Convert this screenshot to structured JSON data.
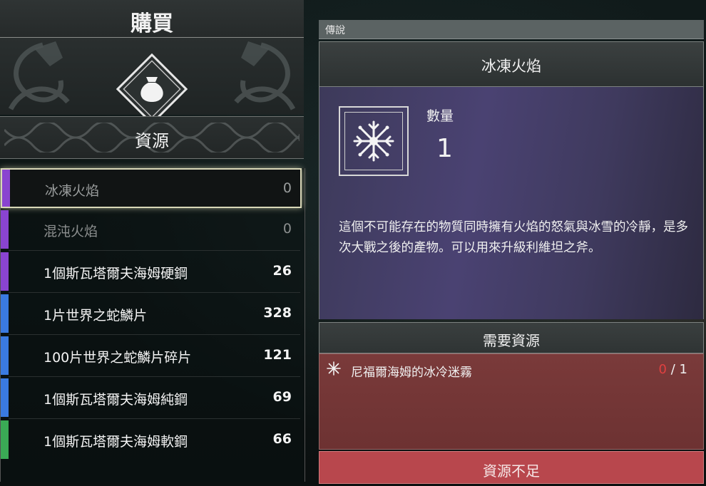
{
  "shop": {
    "title": "購買",
    "emblem_icon": "coin-pouch-icon",
    "category": "資源"
  },
  "items": [
    {
      "name": "冰凍火焰",
      "count": "0",
      "stripe": "#8a44d0",
      "state": "selected"
    },
    {
      "name": "混沌火焰",
      "count": "0",
      "stripe": "#8a44d0",
      "state": "dim"
    },
    {
      "name": "1個斯瓦塔爾夫海姆硬鋼",
      "count": "26",
      "stripe": "#8a44d0",
      "state": "bright"
    },
    {
      "name": "1片世界之蛇鱗片",
      "count": "328",
      "stripe": "#3a7ae0",
      "state": "bright"
    },
    {
      "name": "100片世界之蛇鱗片碎片",
      "count": "121",
      "stripe": "#3a7ae0",
      "state": "bright"
    },
    {
      "name": "1個斯瓦塔爾夫海姆純鋼",
      "count": "69",
      "stripe": "#3a7ae0",
      "state": "bright"
    },
    {
      "name": "1個斯瓦塔爾夫海姆軟鋼",
      "count": "66",
      "stripe": "#3aaa55",
      "state": "bright"
    }
  ],
  "detail": {
    "rarity": "傳說",
    "title": "冰凍火焰",
    "icon": "snowflake-icon",
    "quantity_label": "數量",
    "quantity": "1",
    "description": "這個不可能存在的物質同時擁有火焰的怒氣與冰雪的冷靜，是多次大戰之後的產物。可以用來升級利維坦之斧。",
    "requirements_title": "需要資源",
    "requirement": {
      "icon": "snowflake-icon",
      "name": "尼福爾海姆的冰冷迷霧",
      "have": "0",
      "separator": "/",
      "need": "1"
    },
    "action": "資源不足"
  }
}
